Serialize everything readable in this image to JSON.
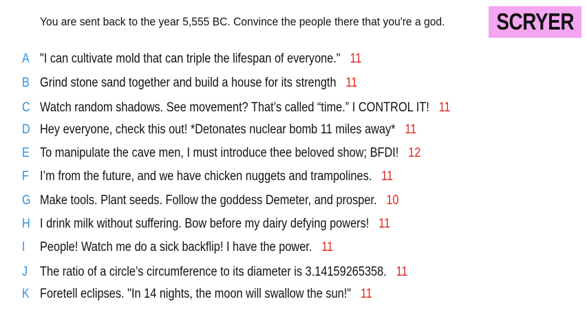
{
  "prompt": "You are sent back to the year 5,555 BC. Convince the people there that you're a god.",
  "logo": {
    "text": "SCRYER",
    "background": "#f5a6f0"
  },
  "colors": {
    "letter": "#2f8fe0",
    "score": "#e8241e",
    "text": "#111111"
  },
  "answers": [
    {
      "letter": "A",
      "text": "\"I can cultivate mold that can triple the lifespan of everyone.\"",
      "score": "11"
    },
    {
      "letter": "B",
      "text": "Grind stone sand together and build a house for its strength",
      "score": "11"
    },
    {
      "letter": "C",
      "text": "Watch random shadows. See movement? That’s called “time.” I CONTROL IT!",
      "score": "11"
    },
    {
      "letter": "D",
      "text": "Hey everyone, check this out! *Detonates nuclear bomb 11 miles away*",
      "score": "11"
    },
    {
      "letter": "E",
      "text": "To manipulate the cave men, I must introduce thee beloved show; BFDI!",
      "score": "12"
    },
    {
      "letter": "F",
      "text": "I’m from the future, and we have chicken nuggets and trampolines.",
      "score": "11"
    },
    {
      "letter": "G",
      "text": "Make tools. Plant seeds. Follow the goddess Demeter, and prosper.",
      "score": "10"
    },
    {
      "letter": "H",
      "text": "I drink milk without suffering. Bow before my dairy defying powers!",
      "score": "11"
    },
    {
      "letter": "I",
      "text": "People! Watch me do a sick backflip! I have the power.",
      "score": "11"
    },
    {
      "letter": "J",
      "text": "The ratio of a circle’s circumference to its diameter is 3.14159265358.",
      "score": "11"
    },
    {
      "letter": "K",
      "text": "Foretell eclipses. \"In 14 nights, the moon will swallow the sun!\"",
      "score": "11"
    }
  ]
}
